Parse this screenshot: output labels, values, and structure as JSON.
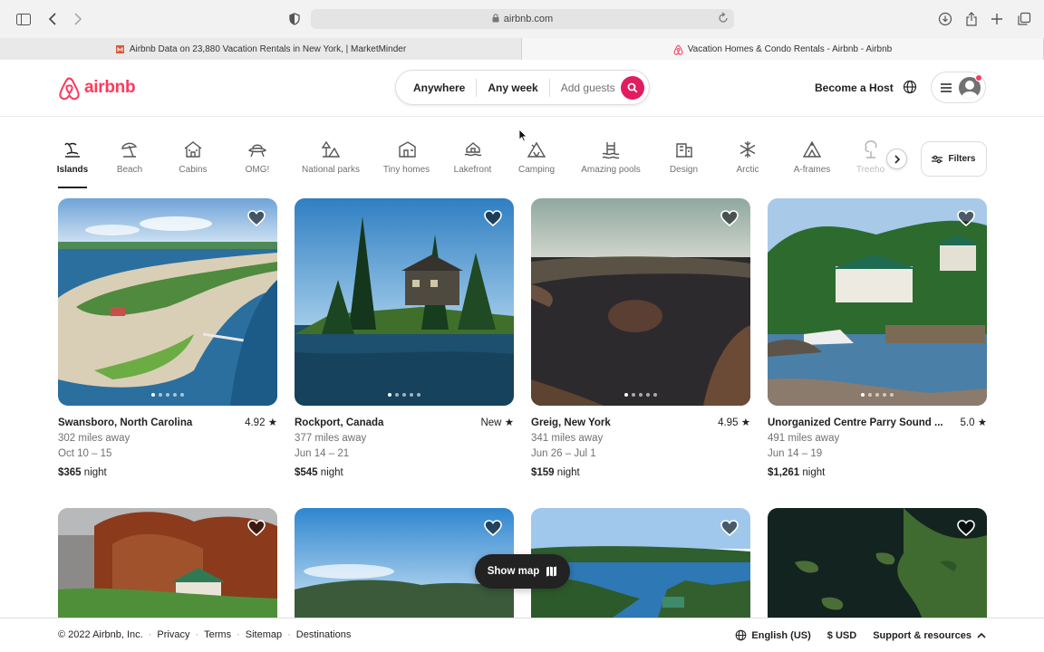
{
  "browser": {
    "url": "airbnb.com",
    "tabs": [
      {
        "title": "Airbnb Data on 23,880 Vacation Rentals in New York, | MarketMinder",
        "active": false
      },
      {
        "title": "Vacation Homes & Condo Rentals - Airbnb - Airbnb",
        "active": true
      }
    ]
  },
  "header": {
    "logo_text": "airbnb",
    "search": {
      "where": "Anywhere",
      "when": "Any week",
      "who": "Add guests"
    },
    "become_host": "Become a Host"
  },
  "categories": [
    {
      "label": "Islands",
      "active": true
    },
    {
      "label": "Beach"
    },
    {
      "label": "Cabins"
    },
    {
      "label": "OMG!"
    },
    {
      "label": "National parks"
    },
    {
      "label": "Tiny homes"
    },
    {
      "label": "Lakefront"
    },
    {
      "label": "Camping"
    },
    {
      "label": "Amazing pools"
    },
    {
      "label": "Design"
    },
    {
      "label": "Arctic"
    },
    {
      "label": "A-frames"
    },
    {
      "label": "Treeho"
    }
  ],
  "filters_label": "Filters",
  "listings": [
    {
      "location": "Swansboro, North Carolina",
      "rating": "4.92",
      "distance": "302 miles away",
      "dates": "Oct 10 – 15",
      "price": "$365",
      "price_unit": "night"
    },
    {
      "location": "Rockport, Canada",
      "rating": "New",
      "distance": "377 miles away",
      "dates": "Jun 14 – 21",
      "price": "$545",
      "price_unit": "night"
    },
    {
      "location": "Greig, New York",
      "rating": "4.95",
      "distance": "341 miles away",
      "dates": "Jun 26 – Jul 1",
      "price": "$159",
      "price_unit": "night"
    },
    {
      "location": "Unorganized Centre Parry Sound ...",
      "rating": "5.0",
      "distance": "491 miles away",
      "dates": "Jun 14 – 19",
      "price": "$1,261",
      "price_unit": "night"
    }
  ],
  "show_map": "Show map",
  "footer": {
    "copyright": "© 2022 Airbnb, Inc.",
    "links": [
      "Privacy",
      "Terms",
      "Sitemap",
      "Destinations"
    ],
    "language": "English (US)",
    "currency": "$ USD",
    "support": "Support & resources"
  },
  "colors": {
    "brand": "#ff385c",
    "search_button": "#e31c5f"
  }
}
